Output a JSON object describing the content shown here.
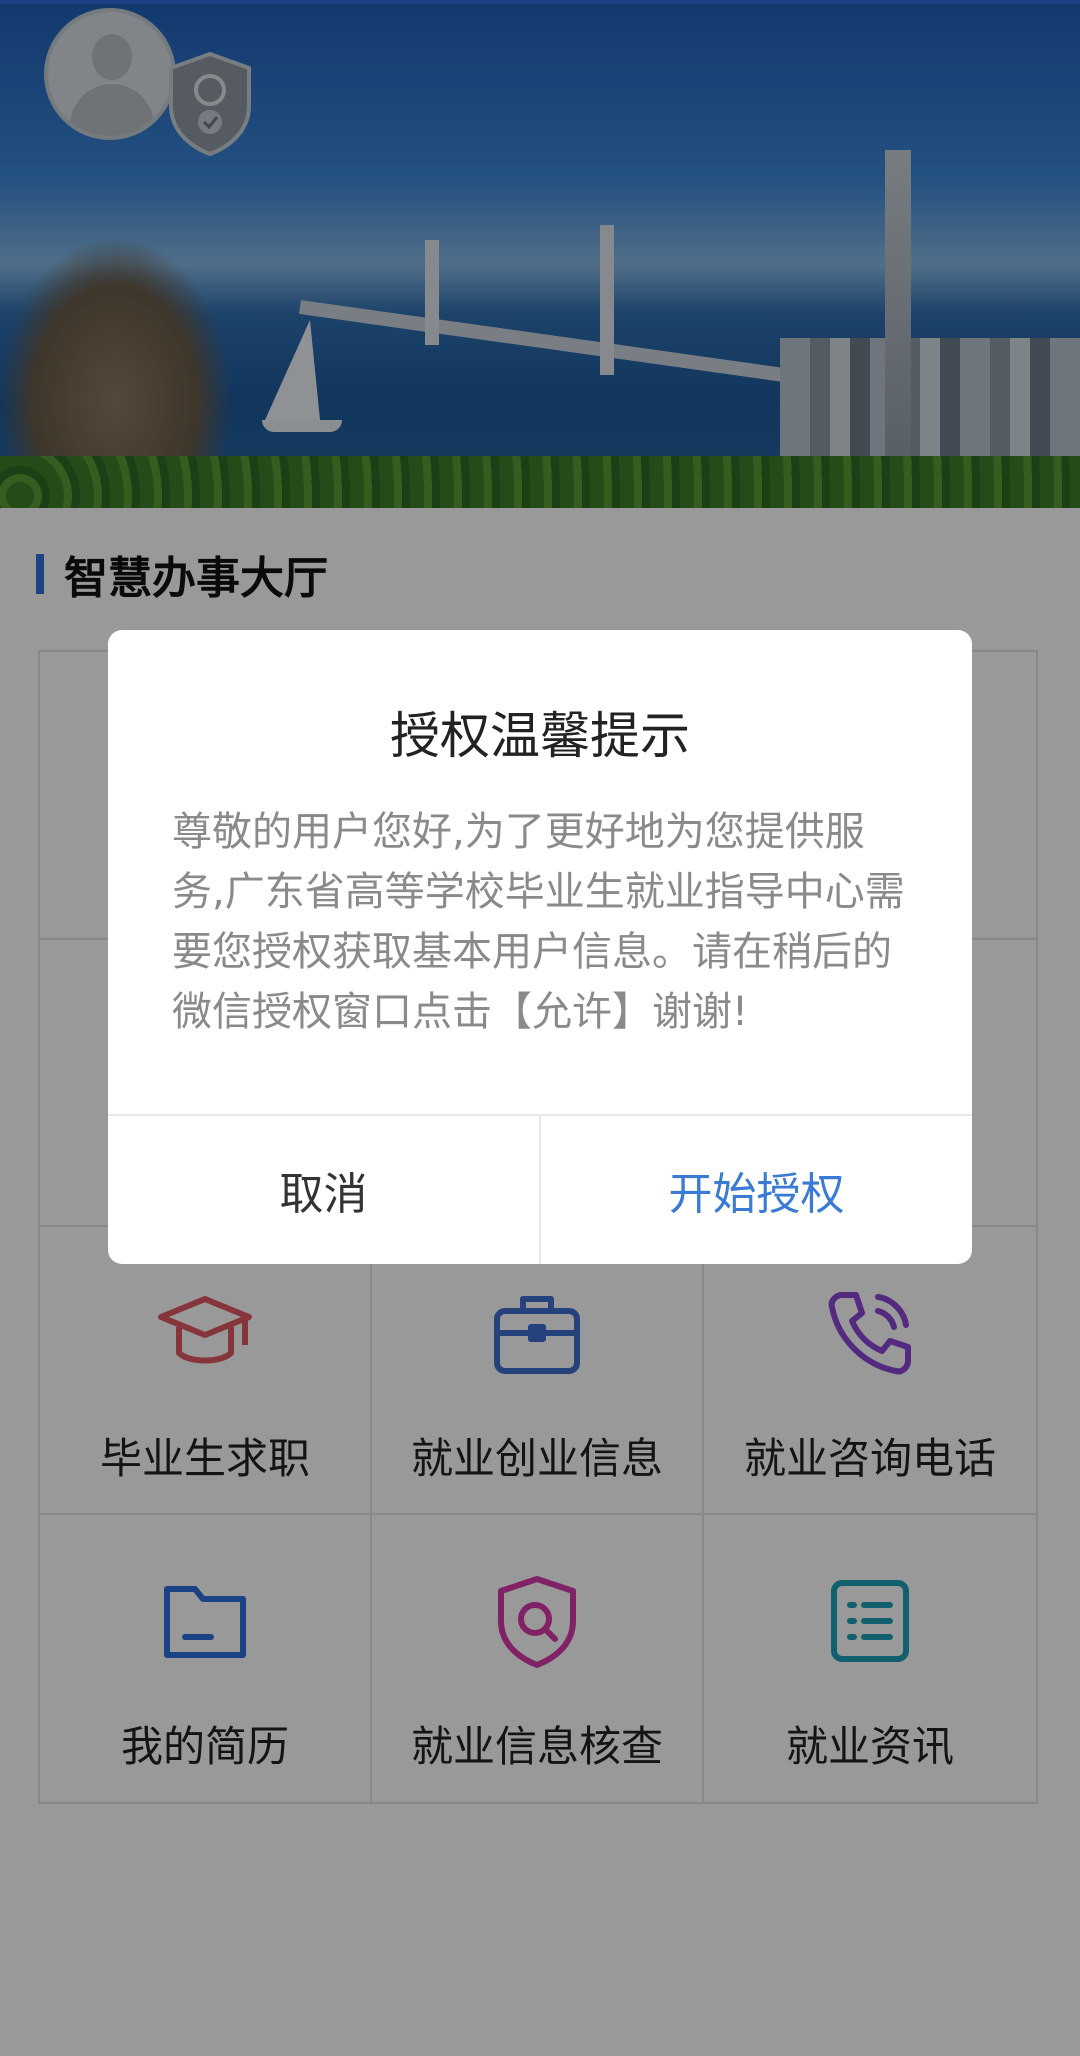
{
  "section": {
    "title": "智慧办事大厅"
  },
  "services": [
    {
      "label": "",
      "icon": ""
    },
    {
      "label": "",
      "icon": ""
    },
    {
      "label": "",
      "icon": ""
    },
    {
      "label": "",
      "icon": ""
    },
    {
      "label": "",
      "icon": ""
    },
    {
      "label": "",
      "icon": ""
    },
    {
      "label": "毕业生求职",
      "icon": "graduation-cap-icon",
      "color": "#e05a62"
    },
    {
      "label": "就业创业信息",
      "icon": "briefcase-icon",
      "color": "#3f6fd0"
    },
    {
      "label": "就业咨询电话",
      "icon": "phone-icon",
      "color": "#8a46d6"
    },
    {
      "label": "我的简历",
      "icon": "folder-icon",
      "color": "#2f6fe0"
    },
    {
      "label": "就业信息核查",
      "icon": "shield-search-icon",
      "color": "#d63aa8"
    },
    {
      "label": "就业资讯",
      "icon": "list-icon",
      "color": "#1f9fb8"
    }
  ],
  "dialog": {
    "title": "授权温馨提示",
    "message": "尊敬的用户您好,为了更好地为您提供服务,广东省高等学校毕业生就业指导中心需要您授权获取基本用户信息。请在稍后的微信授权窗口点击【允许】谢谢!",
    "cancel_label": "取消",
    "confirm_label": "开始授权",
    "confirm_color": "#3a7bd5"
  }
}
